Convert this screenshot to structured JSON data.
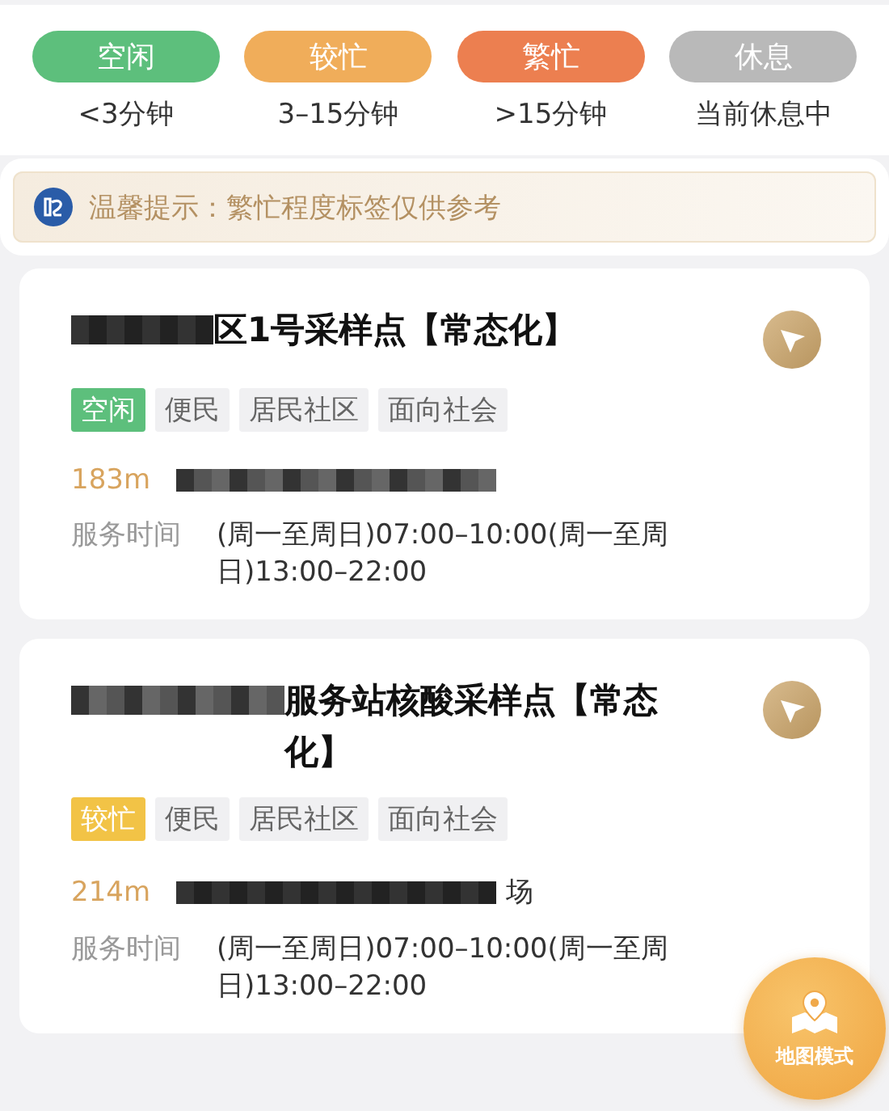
{
  "legend": [
    {
      "label": "空闲",
      "note": "<3分钟",
      "color": "#5dbf7c"
    },
    {
      "label": "较忙",
      "note": "3–15分钟",
      "color": "#f0ad5a"
    },
    {
      "label": "繁忙",
      "note": ">15分钟",
      "color": "#ec7f50"
    },
    {
      "label": "休息",
      "note": "当前休息中",
      "color": "#b9b9b9"
    }
  ],
  "notice": {
    "text": "温馨提示：繁忙程度标签仅供参考"
  },
  "sites": [
    {
      "title": "区1号采样点【常态化】",
      "tags": [
        {
          "label": "空闲",
          "kind": "status",
          "color": "#5dbf7c"
        },
        {
          "label": "便民",
          "kind": "plain"
        },
        {
          "label": "居民社区",
          "kind": "plain"
        },
        {
          "label": "面向社会",
          "kind": "plain"
        }
      ],
      "distance": "183m",
      "hours_label": "服务时间",
      "hours": "(周一至周日)07:00–10:00(周一至周日)13:00–22:00"
    },
    {
      "title": "服务站核酸采样点【常态化】",
      "tags": [
        {
          "label": "较忙",
          "kind": "status",
          "color": "#f2c346"
        },
        {
          "label": "便民",
          "kind": "plain"
        },
        {
          "label": "居民社区",
          "kind": "plain"
        },
        {
          "label": "面向社会",
          "kind": "plain"
        }
      ],
      "distance": "214m",
      "address": "场",
      "hours_label": "服务时间",
      "hours": "(周一至周日)07:00–10:00(周一至周日)13:00–22:00"
    }
  ],
  "map_button": {
    "label": "地图模式"
  }
}
